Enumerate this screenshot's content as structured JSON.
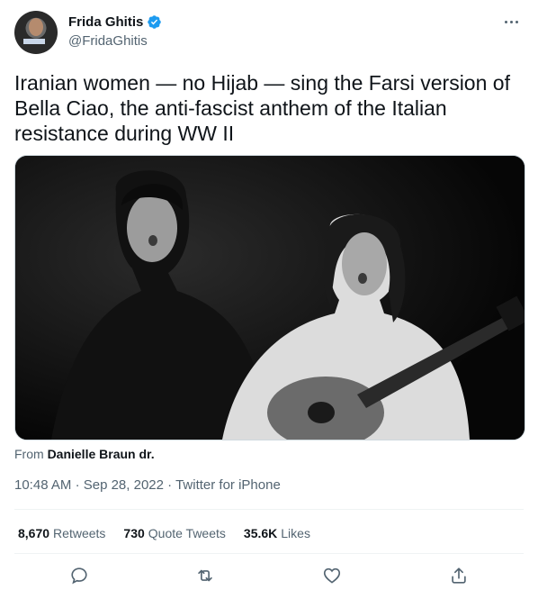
{
  "author": {
    "display_name": "Frida Ghitis",
    "handle": "@FridaGhitis",
    "verified": true
  },
  "tweet": {
    "text": "Iranian women — no Hijab — sing the Farsi version of Bella Ciao, the anti-fascist anthem of the Italian resistance during WW II"
  },
  "media": {
    "from_label": "From",
    "from_name": "Danielle Braun dr."
  },
  "meta": {
    "time": "10:48 AM",
    "sep1": "·",
    "date": "Sep 28, 2022",
    "sep2": "·",
    "source": "Twitter for iPhone"
  },
  "stats": {
    "retweets_count": "8,670",
    "retweets_label": "Retweets",
    "quotes_count": "730",
    "quotes_label": "Quote Tweets",
    "likes_count": "35.6K",
    "likes_label": "Likes"
  },
  "colors": {
    "text": "#0f1419",
    "secondary": "#536471",
    "verified": "#1d9bf0",
    "divider": "#eff3f4"
  },
  "icons": {
    "reply": "reply-icon",
    "retweet": "retweet-icon",
    "like": "heart-icon",
    "share": "share-icon",
    "more": "more-icon",
    "verified": "verified-icon"
  }
}
